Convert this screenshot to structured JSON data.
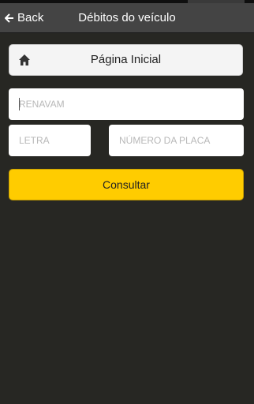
{
  "topbar": {
    "back_label": "Back",
    "title": "Débitos do veículo"
  },
  "home": {
    "label": "Página Inicial",
    "icon": "home-icon"
  },
  "form": {
    "renavam_placeholder": "RENAVAM",
    "letra_placeholder": "LETRA",
    "placa_placeholder": "NÚMERO DA PLACA",
    "submit_label": "Consultar"
  },
  "colors": {
    "background": "#272723",
    "topbar": "#444444",
    "accent": "#ffcc00"
  }
}
